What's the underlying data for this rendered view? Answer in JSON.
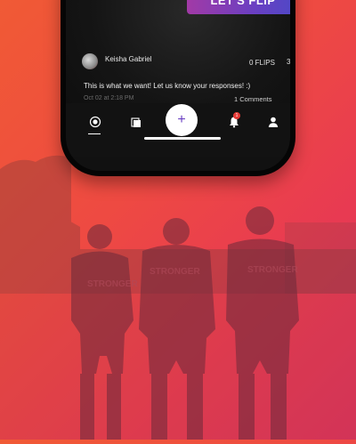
{
  "cta": {
    "label": "LET'S FLIP"
  },
  "post": {
    "author": "Keisha Gabriel",
    "flips": "0 FLIPS",
    "likes": "3",
    "text": "This is what we want! Let us know your responses! :)",
    "timestamp": "Oct 02 at 2:18 PM",
    "comments": "1 Comments"
  },
  "tabbar": {
    "add_label": "+",
    "notification_badge": "1"
  },
  "background": {
    "shirt_text": "STRONGER"
  },
  "colors": {
    "gradient_start": "#f05a35",
    "gradient_end": "#d93060",
    "cta_start": "#a23aa6",
    "cta_end": "#4d49c7",
    "badge": "#e53935"
  }
}
